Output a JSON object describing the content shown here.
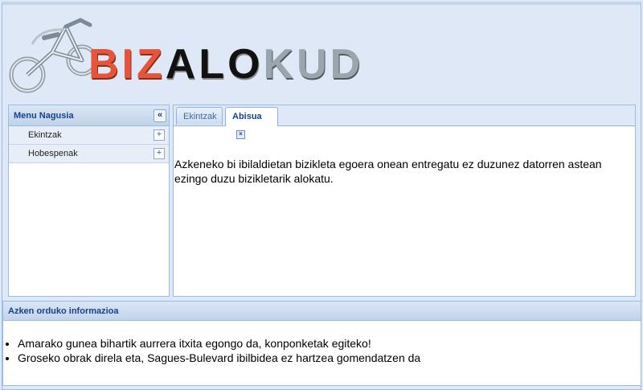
{
  "logo": {
    "part1": "BIZ",
    "part2": "ALO",
    "part3": "KUD",
    "icon": "bicycle-icon"
  },
  "menu": {
    "title": "Menu Nagusia",
    "collapse_icon": "double-chevron-left-icon",
    "items": [
      {
        "label": "Ekintzak",
        "icon": "plus-icon"
      },
      {
        "label": "Hobespenak",
        "icon": "plus-icon"
      }
    ]
  },
  "tabs": {
    "items": [
      {
        "label": "Ekintzak",
        "active": false
      },
      {
        "label": "Abisua",
        "active": true,
        "closable": true
      }
    ],
    "content": "Azkeneko bi ibilaldietan bizikleta egoera onean entregatu ez duzunez datorren astean ezingo duzu bizikletarik alokatu."
  },
  "info": {
    "title": "Azken orduko informazioa",
    "items": [
      "Amarako gunea bihartik aurrera itxita egongo da, konponketak egiteko!",
      "Groseko obrak direla eta, Sagues-Bulevard ibilbidea ez hartzea gomendatzen da"
    ]
  },
  "colors": {
    "accent": "#15428b",
    "border": "#99bbe8",
    "background": "#dfe8f6",
    "logo_red": "#e6543a"
  }
}
